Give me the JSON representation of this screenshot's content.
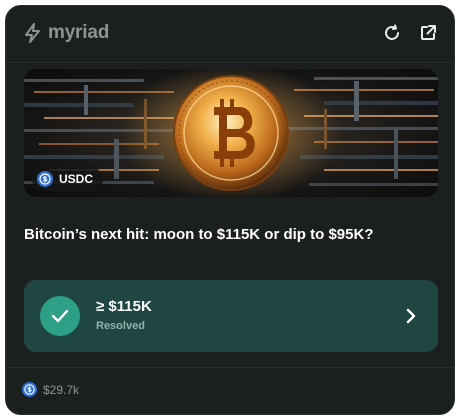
{
  "header": {
    "brand": "myriad",
    "icons": [
      "logo-bolt-icon",
      "refresh-icon",
      "external-link-icon"
    ]
  },
  "market": {
    "image_alt": "bitcoin coin",
    "currency_badge": "USDC",
    "question": "Bitcoin’s next hit: moon to $115K or dip to $95K?",
    "outcome": {
      "label": "≥ $115K",
      "status": "Resolved"
    },
    "volume": "$29.7k"
  },
  "colors": {
    "card_bg": "#1c1f1f",
    "outcome_bg": "#1f4641",
    "check_green": "#2e9f87",
    "usdc_blue": "#2f6fd1",
    "gold": "#e7a43a"
  }
}
